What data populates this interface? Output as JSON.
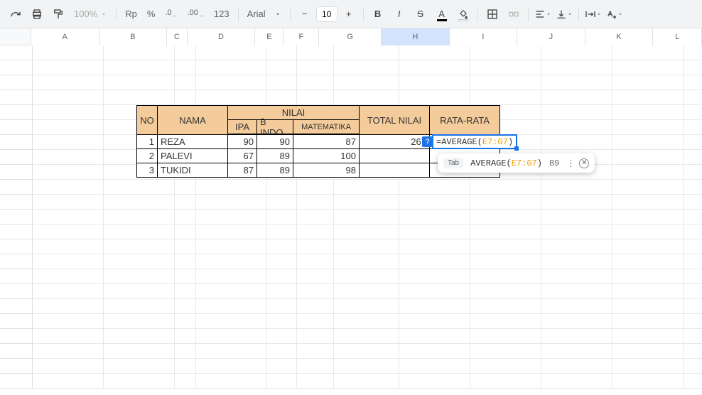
{
  "toolbar": {
    "zoom": "100%",
    "currency": "Rp",
    "percent": "%",
    "dec_less": ".0",
    "dec_more": ".00",
    "num_format": "123",
    "font_name": "Arial",
    "font_size": "10"
  },
  "columns": [
    "A",
    "B",
    "C",
    "D",
    "E",
    "F",
    "G",
    "H",
    "I",
    "J",
    "K",
    "L"
  ],
  "selected_column": "H",
  "table": {
    "headers": {
      "no": "NO",
      "nama": "NAMA",
      "nilai": "NILAI",
      "ipa": "IPA",
      "bindo": "B INDO",
      "mtk": "MATEMATIKA",
      "total": "TOTAL NILAI",
      "rata": "RATA-RATA"
    },
    "rows": [
      {
        "no": "1",
        "nama": "REZA",
        "ipa": "90",
        "bindo": "90",
        "mtk": "87",
        "total": "267"
      },
      {
        "no": "2",
        "nama": "PALEVI",
        "ipa": "67",
        "bindo": "89",
        "mtk": "100",
        "total": ""
      },
      {
        "no": "3",
        "nama": "TUKIDI",
        "ipa": "87",
        "bindo": "89",
        "mtk": "98",
        "total": ""
      }
    ]
  },
  "formula": {
    "text_prefix": "=AVERAGE(",
    "text_range": "E7:G7",
    "text_suffix": ")",
    "help_badge": "?"
  },
  "suggestion": {
    "tab_label": "Tab",
    "func_prefix": "AVERAGE(",
    "func_range": "E7:G7",
    "func_suffix": ")",
    "preview": "89"
  },
  "chart_data": {
    "type": "table",
    "columns": [
      "NO",
      "NAMA",
      "IPA",
      "B INDO",
      "MATEMATIKA",
      "TOTAL NILAI",
      "RATA-RATA"
    ],
    "rows": [
      [
        1,
        "REZA",
        90,
        90,
        87,
        267,
        null
      ],
      [
        2,
        "PALEVI",
        67,
        89,
        100,
        null,
        null
      ],
      [
        3,
        "TUKIDI",
        87,
        89,
        98,
        null,
        null
      ]
    ]
  }
}
